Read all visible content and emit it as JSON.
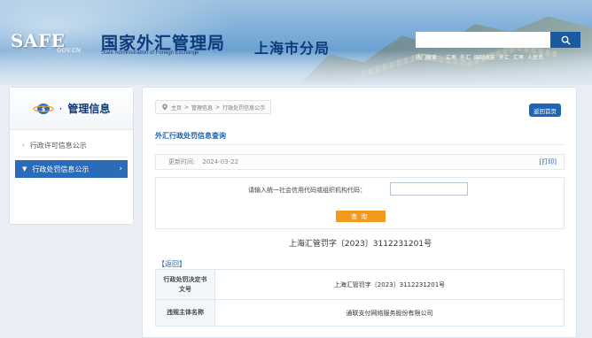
{
  "header": {
    "logo_safe": "SAFE",
    "logo_gov": "GOV.CN",
    "logo_cn": "国家外汇管理局",
    "logo_en": "State Administration of Foreign Exchange",
    "branch": "上海市分局",
    "search": {
      "placeholder": ""
    },
    "nav": [
      "热门搜索：",
      "汇率",
      "外汇",
      "国际收支",
      "外汇",
      "汇率",
      "人民币"
    ]
  },
  "sidebar": {
    "title": "管理信息",
    "items": [
      {
        "label": "行政许可信息公示",
        "active": false
      },
      {
        "label": "行政处罚信息公示",
        "active": true
      }
    ]
  },
  "main": {
    "breadcrumb": [
      "主页",
      ">",
      "管理信息",
      ">",
      "行政处罚信息公示"
    ],
    "home_button": "返回首页",
    "section_title": "外汇行政处罚信息查询",
    "update_label": "更新时间:",
    "update_date": "2024-03-22",
    "print_label": "[打印]",
    "query_label": "请输入统一社会信用代码或组织机构代码：",
    "query_value": "",
    "query_button": "查询",
    "doc_number": "上海汇管罚字〔2023〕3112231201号",
    "back_label": "【返回】",
    "table": [
      {
        "header": "行政处罚决定书文号",
        "value": "上海汇管罚字〔2023〕3112231201号"
      },
      {
        "header": "违规主体名称",
        "value": "通联支付网络服务股份有限公司"
      }
    ]
  }
}
